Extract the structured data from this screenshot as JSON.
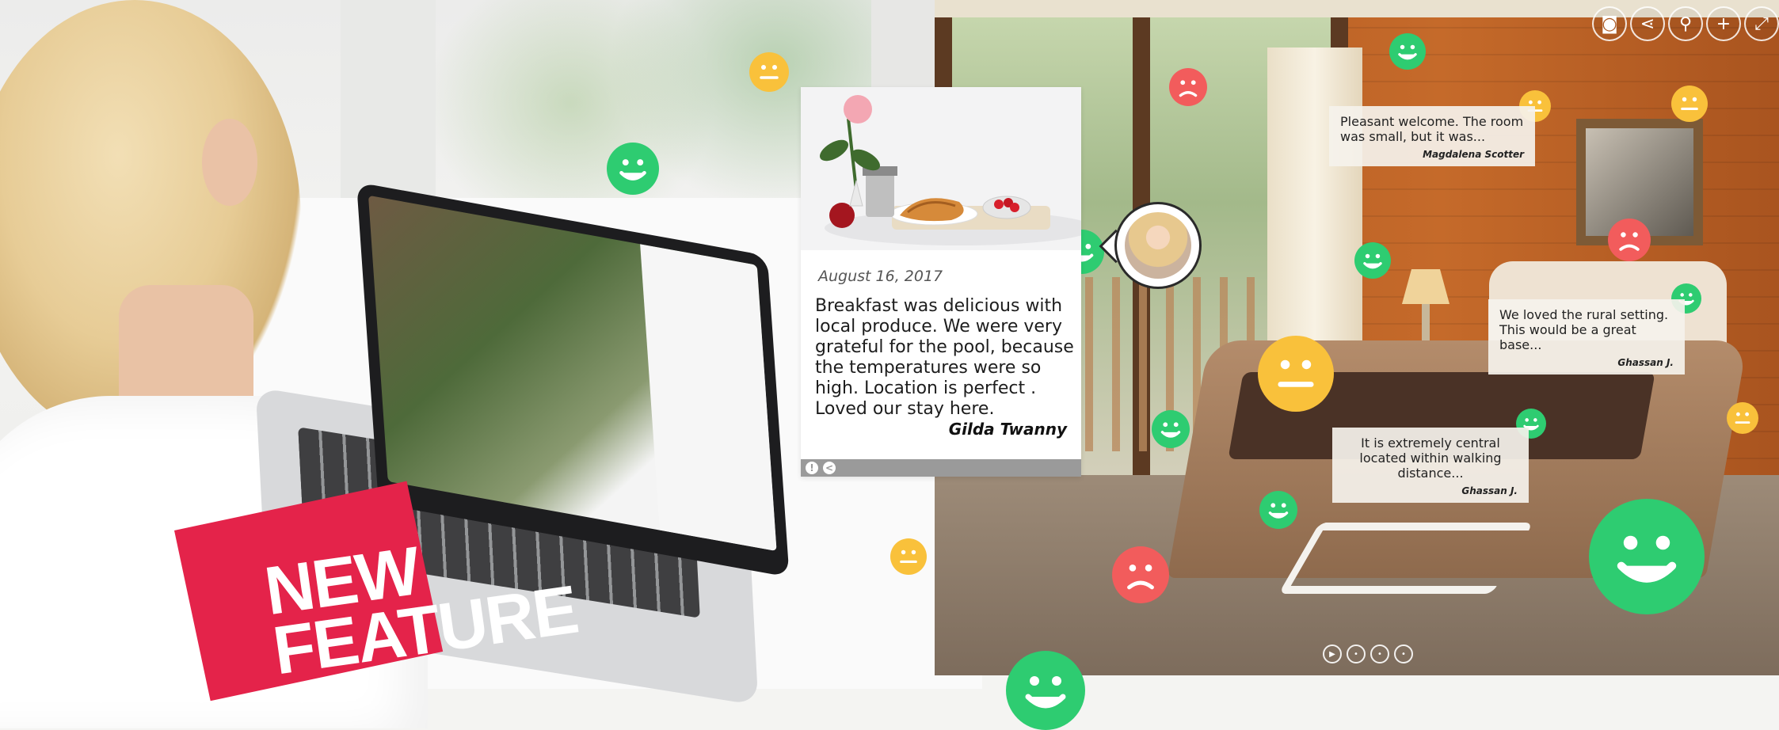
{
  "promo": {
    "banner_line1": "NEW",
    "banner_line2": "FEATURE",
    "banner_color": "#e4234a"
  },
  "toolbar": {
    "buttons": [
      {
        "icon": "vr-glasses-icon",
        "glyph": "◙"
      },
      {
        "icon": "share-icon",
        "glyph": "⋖"
      },
      {
        "icon": "map-pin-icon",
        "glyph": "⚲"
      },
      {
        "icon": "plus-icon",
        "glyph": "+"
      },
      {
        "icon": "fullscreen-icon",
        "glyph": "⤢"
      }
    ]
  },
  "review_card": {
    "date": "August 16, 2017",
    "text": "Breakfast was delicious with local produce. We were very grateful for the pool, because the temperatures were so high. Location is perfect . Loved our stay here.",
    "author": "Gilda Twanny",
    "rating": "positive",
    "footer_icons": [
      "report-icon",
      "share-icon"
    ],
    "footer_glyphs": [
      "!",
      "<"
    ]
  },
  "tooltips": [
    {
      "text": "Pleasant welcome. The room was small, but it was...",
      "author": "Magdalena Scotter"
    },
    {
      "text": "We loved the rural setting. This would be a great base...",
      "author": "Ghassan J."
    },
    {
      "text": "It is extremely central located within walking distance...",
      "author": "Ghassan J."
    }
  ],
  "pager": {
    "items": [
      {
        "icon": "play-icon",
        "glyph": "▶"
      },
      {
        "icon": "dot-icon",
        "glyph": "•"
      },
      {
        "icon": "dot-icon",
        "glyph": "•"
      },
      {
        "icon": "dot-icon",
        "glyph": "•"
      }
    ]
  },
  "colors": {
    "positive": "#2ecc71",
    "neutral": "#f9c13b",
    "negative": "#f25c5c"
  }
}
